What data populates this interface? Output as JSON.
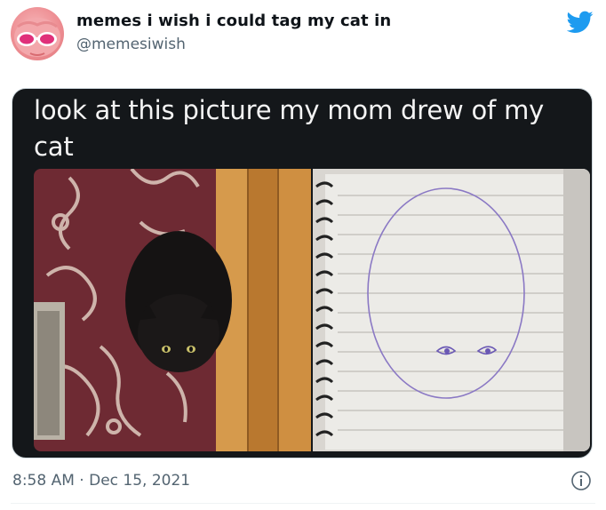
{
  "author": {
    "display_name": "memes i wish i could tag my cat in",
    "handle": "@memesiwish",
    "avatar_icon": "avatar-pink-cat-sunglasses",
    "platform_icon": "twitter-bird-icon",
    "brand_color": "#1d9bf0"
  },
  "media": {
    "caption": "look at this picture my mom drew of my cat",
    "left_panel": "photo-black-cat-on-rug",
    "right_panel": "notebook-drawing-oval-with-eyes"
  },
  "footer": {
    "time": "8:58 AM",
    "separator": "·",
    "date": "Dec 15, 2021",
    "info_icon": "info-icon"
  }
}
